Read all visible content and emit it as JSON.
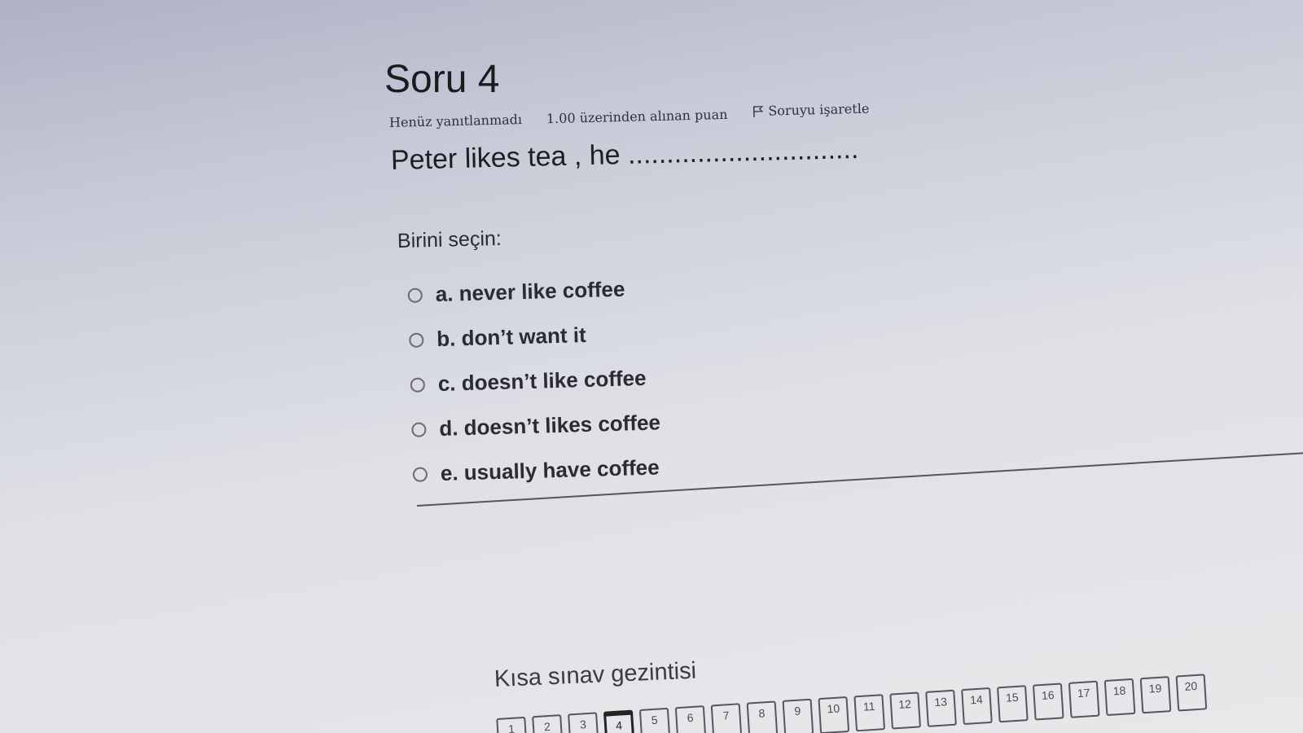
{
  "question": {
    "title": "Soru 4",
    "status": "Henüz yanıtlanmadı",
    "score": "1.00 üzerinden alınan puan",
    "flag_label": "Soruyu işaretle",
    "text": "Peter likes tea , he ..............................",
    "prompt": "Birini seçin:",
    "options": [
      {
        "label": "a. never like coffee"
      },
      {
        "label": "b. don’t want it"
      },
      {
        "label": "c. doesn’t like coffee"
      },
      {
        "label": "d. doesn’t likes coffee"
      },
      {
        "label": "e. usually have coffee"
      }
    ]
  },
  "navigation": {
    "title": "Kısa sınav gezintisi",
    "current": "4",
    "buttons": [
      "1",
      "2",
      "3",
      "4",
      "5",
      "6",
      "7",
      "8",
      "9",
      "10",
      "11",
      "12",
      "13",
      "14",
      "15",
      "16",
      "17",
      "18",
      "19",
      "20"
    ]
  },
  "colors": {
    "text": "#222222",
    "border": "#55555c"
  },
  "icons": {
    "flag": "flag-icon",
    "radio": "radio-icon"
  }
}
